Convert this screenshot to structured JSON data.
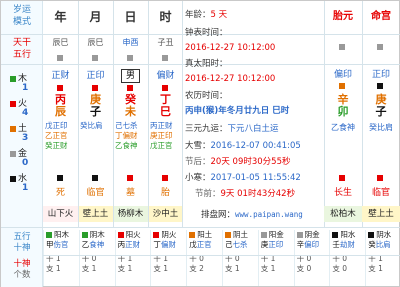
{
  "left_labels": {
    "top_line1": "岁运",
    "top_line2": "模式",
    "tiangan": "天干",
    "wuxing": "五行",
    "mu": "木",
    "mu_count": "1",
    "huo": "火",
    "huo_count": "4",
    "tu": "土",
    "tu_count": "3",
    "jin": "金",
    "jin_count": "0",
    "shui": "水",
    "shui_count": "1",
    "bottom_line1": "五行",
    "bottom_line2": "十神",
    "bottom_line3": "十神",
    "bottom_line4": "个数"
  },
  "pillars": [
    {
      "head": "年",
      "stem_top": "辰巳",
      "shishen": "正财",
      "gan": "丙",
      "zhi": "辰",
      "hidden": [
        "戊正印",
        "乙正官",
        "癸正财"
      ],
      "hidden_note": "",
      "xingyun": "死",
      "nayin": "山下火",
      "marker": "black"
    },
    {
      "head": "月",
      "stem_top": "辰巳",
      "shishen": "正印",
      "gan": "庚",
      "zhi": "子",
      "hidden": [
        "癸比肩"
      ],
      "xingyun": "临官",
      "nayin": "壁上土",
      "marker": "black"
    },
    {
      "head": "日",
      "stem_top": "申酉",
      "shishen": "男",
      "gan": "癸",
      "zhi": "未",
      "hidden": [
        "己七杀",
        "丁偏财",
        "乙食神"
      ],
      "xingyun": "墓",
      "nayin": "杨柳木",
      "marker": "red"
    },
    {
      "head": "时",
      "stem_top": "子丑",
      "shishen": "偏财",
      "gan": "丁",
      "zhi": "巳",
      "hidden": [
        "丙正财",
        "庚正印",
        "戊正官"
      ],
      "xingyun": "胎",
      "nayin": "沙中土",
      "marker": "red"
    }
  ],
  "info": {
    "age_label": "年龄：",
    "age_value": "5 天",
    "clock_label": "钟表时间：",
    "clock_value": "2016-12-27 10:12:00",
    "true_solar_label": "真太阳时：",
    "true_solar_value": "2016-12-27 10:12:00",
    "lunar_label": "农历时间：",
    "lunar_value": "丙申(猴)年冬月廿九日 巳时",
    "sanyuan_label": "三元九运：",
    "sanyuan_value": "下元八白土运",
    "daxue_label": "大雪：",
    "daxue_value": "2016-12-07 00:41:05",
    "jiehou_label": "节后：",
    "jiehou_value": "20天 09时30分55秒",
    "xiaohan_label": "小寒：",
    "xiaohan_value": "2017-01-05 11:55:42",
    "jieqian_label": "节前：",
    "jieqian_value": "9天 01时43分42秒",
    "site_label": "排盘网：",
    "site_value": "www.paipan.wang"
  },
  "taiyuan": {
    "head": "胎元",
    "shishen": "偏印",
    "gan": "辛",
    "zhi": "卯",
    "hidden": "乙食神",
    "xingyun": "长生",
    "nayin": "松柏木"
  },
  "minggong": {
    "head": "命宫",
    "shishen": "正印",
    "gan": "庚",
    "zhi": "子",
    "hidden": "癸比肩",
    "xingyun": "临官",
    "nayin": "壁上土"
  },
  "bottom_stats": [
    {
      "a": "阳木",
      "b": "伤官",
      "c": "甲",
      "count_a": "干 1",
      "count_b": "支 1"
    },
    {
      "a": "阴木",
      "b": "食神",
      "c": "乙",
      "count_a": "干 0",
      "count_b": "支 1"
    },
    {
      "a": "阳火",
      "b": "正财",
      "c": "丙",
      "count_a": "干 1",
      "count_b": "支 1"
    },
    {
      "a": "阴火",
      "b": "偏财",
      "c": "丁",
      "count_a": "干 1",
      "count_b": "支 1"
    },
    {
      "a": "阳土",
      "b": "正官",
      "c": "戊",
      "count_a": "干 0",
      "count_b": "支 2"
    },
    {
      "a": "阴土",
      "b": "七杀",
      "c": "己",
      "count_a": "干 0",
      "count_b": "支 1"
    },
    {
      "a": "阳金",
      "b": "正印",
      "c": "庚",
      "count_a": "干 1",
      "count_b": "支 1"
    },
    {
      "a": "阴金",
      "b": "偏印",
      "c": "辛",
      "count_a": "干 0",
      "count_b": "支 0"
    },
    {
      "a": "阳水",
      "b": "劫财",
      "c": "壬",
      "count_a": "干 0",
      "count_b": "支 0"
    },
    {
      "a": "阴水",
      "b": "比肩",
      "c": "癸",
      "count_a": "干 1",
      "count_b": "支 1"
    }
  ],
  "colors": {
    "mu": "#2a9d2a",
    "huo": "#e60000",
    "tu": "#e07000",
    "jin": "#999999",
    "shui": "#111111"
  }
}
